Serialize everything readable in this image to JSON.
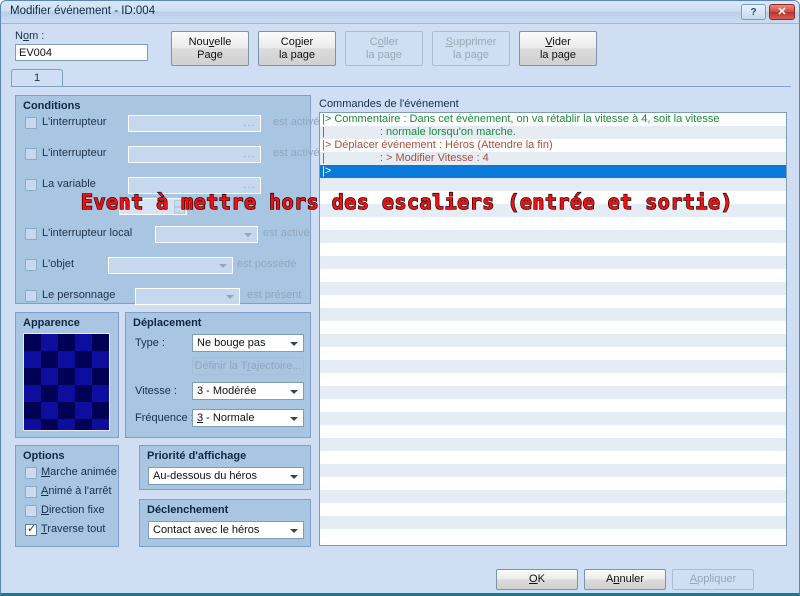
{
  "window": {
    "title": "Modifier événement - ID:004",
    "help_label": "?",
    "close_label": "✕"
  },
  "name_field": {
    "label_pre": "N",
    "label_underlined": "o",
    "label_post": "m :",
    "value": "EV004"
  },
  "toolbar": [
    {
      "line1_pre": "Nou",
      "line1_u": "v",
      "line1_post": "elle",
      "line2": "Page",
      "enabled": true
    },
    {
      "line1_pre": "Co",
      "line1_u": "p",
      "line1_post": "ier",
      "line2": "la page",
      "enabled": true
    },
    {
      "line1_pre": "C",
      "line1_u": "o",
      "line1_post": "ller",
      "line2": "la page",
      "enabled": false
    },
    {
      "line1_pre": "",
      "line1_u": "S",
      "line1_post": "upprimer",
      "line2": "la page",
      "enabled": false
    },
    {
      "line1_pre": "",
      "line1_u": "V",
      "line1_post": "ider",
      "line2": "la page",
      "enabled": true
    }
  ],
  "tabs": [
    {
      "label": "1",
      "active": true
    }
  ],
  "conditions": {
    "title": "Conditions",
    "rows": [
      {
        "label": "L'interrupteur",
        "checked": false,
        "control": "field",
        "suffix": "est activé"
      },
      {
        "label": "L'interrupteur",
        "checked": false,
        "control": "field",
        "suffix": "est activé"
      },
      {
        "label": "La variable",
        "checked": false,
        "control": "field",
        "suffix": ""
      },
      {
        "label": "L'interrupteur local",
        "checked": false,
        "control": "combo",
        "suffix": "est activé"
      },
      {
        "label": "L'objet",
        "checked": false,
        "control": "combo",
        "suffix": "est possédé"
      },
      {
        "label": "Le personnage",
        "checked": false,
        "control": "combo",
        "suffix": "est présent"
      }
    ],
    "spinner_value": ""
  },
  "apparence": {
    "title": "Apparence",
    "thumb_colors": [
      "#000055",
      "#0d0d9e"
    ]
  },
  "deplacement": {
    "title": "Déplacement",
    "type_label": "Type :",
    "type_value": "Ne bouge pas",
    "trajectoire_pre": "Définir la T",
    "trajectoire_u": "r",
    "trajectoire_post": "ajectoire...",
    "vitesse_label": "Vitesse :",
    "vitesse_value": "3 - Modérée",
    "frequence_label": "Fréquence :",
    "frequence_value_u": "3",
    "frequence_value_post": " - Normale"
  },
  "options": {
    "title": "Options",
    "items": [
      {
        "u": "M",
        "post": "arche animée",
        "checked": false
      },
      {
        "u": "A",
        "post": "nimé à l'arrêt",
        "checked": false,
        "u2": "n"
      },
      {
        "u": "D",
        "post": "irection fixe",
        "checked": false
      },
      {
        "u": "T",
        "post": "raverse tout",
        "checked": true
      }
    ]
  },
  "priorite": {
    "title": "Priorité d'affichage",
    "value": "Au-dessous du héros"
  },
  "declenchement": {
    "title": "Déclenchement",
    "value": "Contact avec le héros"
  },
  "commands": {
    "caption": "Commandes de l'événement",
    "rows": [
      {
        "text": "|> Commentaire : Dans cet évènement, on va rétablir la vitesse à 4, soit la vitesse",
        "style": "comment"
      },
      {
        "text": "|                  : normale lorsqu'on marche.",
        "style": "comment"
      },
      {
        "text": "|> Déplacer événement : Héros (Attendre la fin)",
        "style": "move"
      },
      {
        "text": "|                  : > Modifier Vitesse : 4",
        "style": "move"
      },
      {
        "text": "|>",
        "style": "sel"
      }
    ],
    "empty_rows": 28
  },
  "annotation": {
    "text": "Event à mettre hors des escaliers (entrée et sortie)",
    "color": "#ee1111"
  },
  "footer": [
    {
      "pre": "",
      "u": "O",
      "post": "K",
      "enabled": true
    },
    {
      "pre": "A",
      "u": "n",
      "post": "nuler",
      "enabled": true
    },
    {
      "pre": "",
      "u": "A",
      "post": "ppliquer",
      "enabled": false
    }
  ]
}
